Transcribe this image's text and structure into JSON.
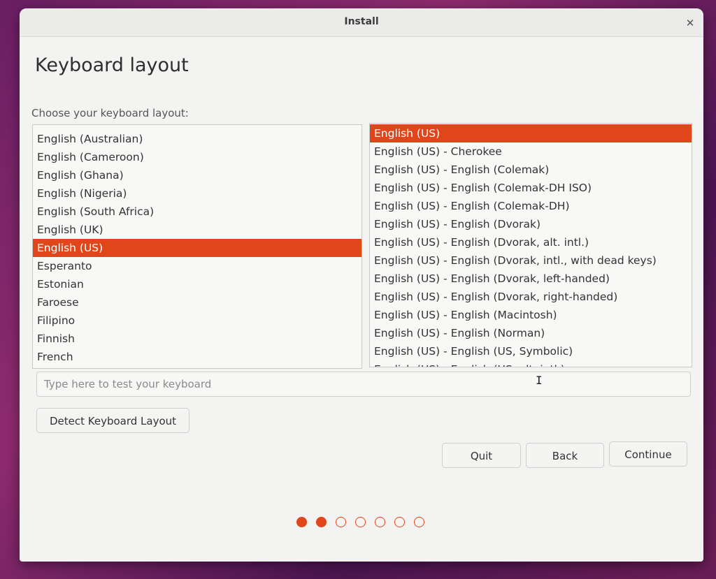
{
  "window": {
    "title": "Install"
  },
  "page": {
    "heading": "Keyboard layout",
    "subheading": "Choose your keyboard layout:"
  },
  "layouts": [
    "English (Australian)",
    "English (Cameroon)",
    "English (Ghana)",
    "English (Nigeria)",
    "English (South Africa)",
    "English (UK)",
    "English (US)",
    "Esperanto",
    "Estonian",
    "Faroese",
    "Filipino",
    "Finnish",
    "French"
  ],
  "layouts_selected": "English (US)",
  "variants": [
    "English (US)",
    "English (US) - Cherokee",
    "English (US) - English (Colemak)",
    "English (US) - English (Colemak-DH ISO)",
    "English (US) - English (Colemak-DH)",
    "English (US) - English (Dvorak)",
    "English (US) - English (Dvorak, alt. intl.)",
    "English (US) - English (Dvorak, intl., with dead keys)",
    "English (US) - English (Dvorak, left-handed)",
    "English (US) - English (Dvorak, right-handed)",
    "English (US) - English (Macintosh)",
    "English (US) - English (Norman)",
    "English (US) - English (US, Symbolic)",
    "English (US) - English (US, alt. intl.)"
  ],
  "variants_selected": "English (US)",
  "test": {
    "placeholder": "Type here to test your keyboard"
  },
  "buttons": {
    "detect": "Detect Keyboard Layout",
    "quit": "Quit",
    "back": "Back",
    "continue": "Continue"
  },
  "progress": {
    "total_steps": 7,
    "completed_steps": 2,
    "accent_color": "#e0461a"
  }
}
